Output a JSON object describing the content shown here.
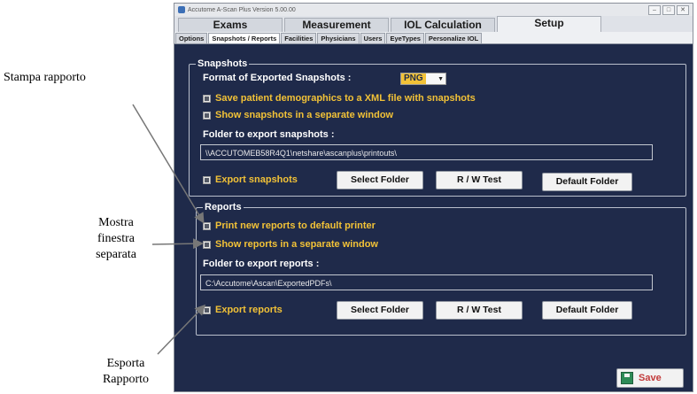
{
  "annotations": {
    "print_report": "Stampa rapporto",
    "show_window": [
      "Mostra",
      "finestra",
      "separata"
    ],
    "export_report": [
      "Esporta",
      "Rapporto"
    ]
  },
  "window": {
    "title": "Accutome A-Scan Plus Version 5.00.00",
    "controls": [
      "–",
      "□",
      "✕"
    ]
  },
  "main_tabs": [
    {
      "label": "Exams",
      "active": false
    },
    {
      "label": "Measurement",
      "active": false
    },
    {
      "label": "IOL Calculation",
      "active": false
    },
    {
      "label": "Setup",
      "active": true
    }
  ],
  "sub_tabs": [
    {
      "label": "Options",
      "active": false
    },
    {
      "label": "Snapshots / Reports",
      "active": true
    },
    {
      "label": "Facilities",
      "active": false
    },
    {
      "label": "Physicians",
      "active": false
    },
    {
      "label": "Users",
      "active": false
    },
    {
      "label": "EyeTypes",
      "active": false
    },
    {
      "label": "Personalize IOL",
      "active": false
    }
  ],
  "snapshots": {
    "legend": "Snapshots",
    "format_label": "Format of Exported Snapshots :",
    "format_value": "PNG",
    "save_demographics": "Save patient demographics to a XML file with snapshots",
    "show_separate": "Show snapshots in a separate window",
    "folder_label": "Folder to export snapshots :",
    "folder_path": "\\\\ACCUTOMEB58R4Q1\\netshare\\ascanplus\\printouts\\",
    "export_label": "Export snapshots",
    "select_folder": "Select Folder",
    "rw_test": "R / W Test",
    "default_folder": "Default Folder"
  },
  "reports": {
    "legend": "Reports",
    "print_default": "Print new reports to default printer",
    "show_separate": "Show reports in a separate window",
    "folder_label": "Folder to export reports :",
    "folder_path": "C:\\Accutome\\Ascan\\ExportedPDFs\\",
    "export_label": "Export reports",
    "select_folder": "Select Folder",
    "rw_test": "R / W Test",
    "default_folder": "Default Folder"
  },
  "footer": {
    "save_label": "Save"
  },
  "colors": {
    "panel_bg": "#1f2a4a",
    "accent_yellow": "#f2c237",
    "save_text": "#c23a3a"
  }
}
